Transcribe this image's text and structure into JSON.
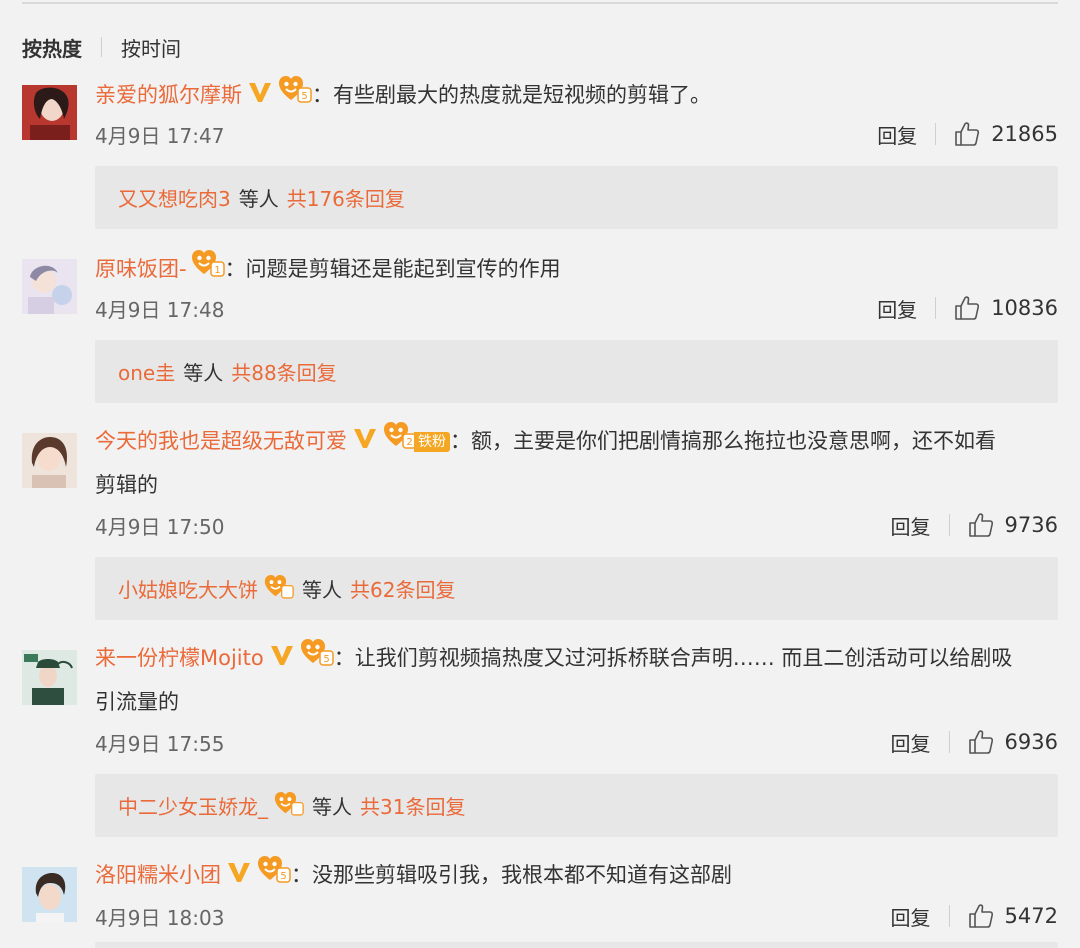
{
  "sort": {
    "hot": "按热度",
    "time": "按时间"
  },
  "comments": [
    {
      "username": "亲爱的狐尔摩斯",
      "verified": true,
      "fan_level": "5",
      "fan_label": "",
      "colon": "：",
      "text": "有些剧最大的热度就是短视频的剪辑了。",
      "time": "4月9日 17:47",
      "reply_label": "回复",
      "likes": "21865",
      "reply_preview": {
        "names": "又又想吃肉3",
        "middle": "等人",
        "total": "共176条回复"
      }
    },
    {
      "username": "原味饭团-",
      "verified": false,
      "fan_level": "1",
      "fan_label": "",
      "colon": "：",
      "text": "问题是剪辑还是能起到宣传的作用",
      "time": "4月9日 17:48",
      "reply_label": "回复",
      "likes": "10836",
      "reply_preview": {
        "names": "one圭",
        "middle": "等人",
        "total": "共88条回复"
      }
    },
    {
      "username": "今天的我也是超级无敌可爱",
      "verified": true,
      "fan_level": "2",
      "fan_label": "铁粉",
      "colon": "：",
      "text": "额，主要是你们把剧情搞那么拖拉也没意思啊，还不如看",
      "text2": "剪辑的",
      "time": "4月9日 17:50",
      "reply_label": "回复",
      "likes": "9736",
      "reply_preview": {
        "names": "小姑娘吃大大饼",
        "middle": "等人",
        "total": "共62条回复"
      }
    },
    {
      "username": "来一份柠檬Mojito",
      "verified": true,
      "fan_level": "5",
      "fan_label": "",
      "colon": "：",
      "text": "让我们剪视频搞热度又过河拆桥联合声明…… 而且二创活动可以给剧吸",
      "text2": "引流量的",
      "time": "4月9日 17:55",
      "reply_label": "回复",
      "likes": "6936",
      "reply_preview": {
        "names": "中二少女玉娇龙_",
        "middle": "等人",
        "total": "共31条回复"
      }
    },
    {
      "username": "洛阳糯米小团",
      "verified": true,
      "fan_level": "5",
      "fan_label": "",
      "colon": "：",
      "text": "没那些剪辑吸引我，我根本都不知道有这部剧",
      "time": "4月9日 18:03",
      "reply_label": "回复",
      "likes": "5472"
    }
  ],
  "colors": {
    "accent": "#ea6a3a",
    "verified": "#f5a623",
    "fan_badge": "#f5a623",
    "background": "#f2f2f2",
    "reply_box": "#e7e7e7"
  },
  "icons": {
    "verified": "v-badge-icon",
    "fan": "fan-heart-badge-icon",
    "like": "thumbs-up-icon"
  }
}
